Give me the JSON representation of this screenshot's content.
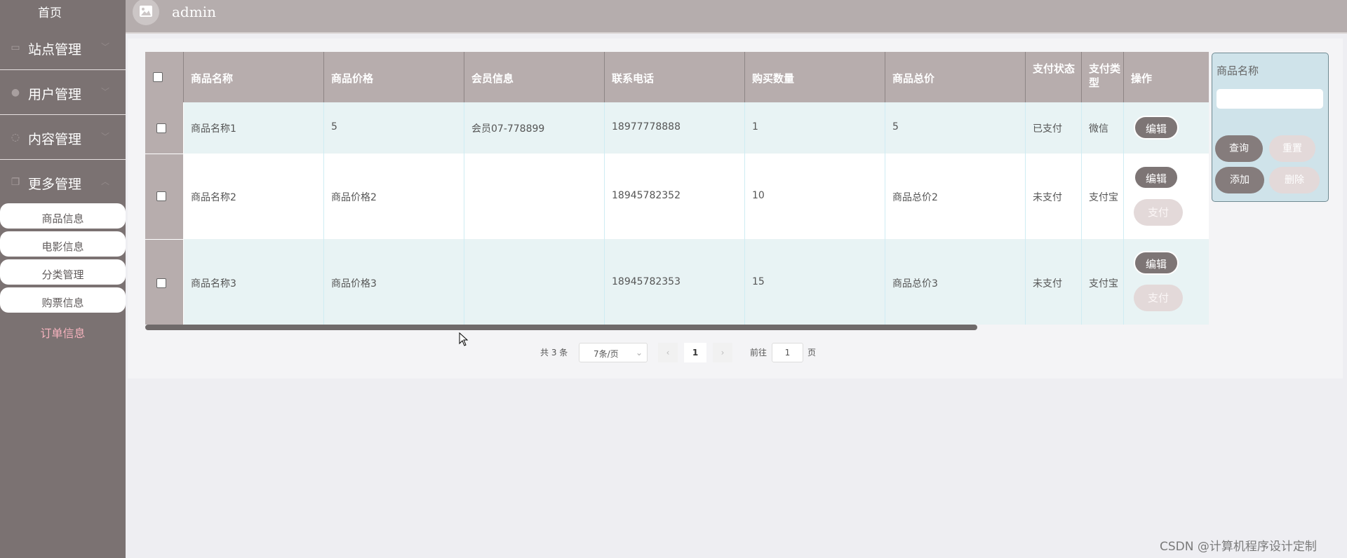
{
  "sidebar": {
    "home": "首页",
    "menus": [
      {
        "label": "站点管理",
        "icon": "monitor-icon"
      },
      {
        "label": "用户管理",
        "icon": "user-icon"
      },
      {
        "label": "内容管理",
        "icon": "chat-icon"
      },
      {
        "label": "更多管理",
        "icon": "copy-icon"
      }
    ],
    "submenu": [
      "商品信息",
      "电影信息",
      "分类管理",
      "购票信息"
    ],
    "active": "订单信息"
  },
  "header": {
    "user": "admin"
  },
  "table": {
    "columns": [
      "商品名称",
      "商品价格",
      "会员信息",
      "联系电话",
      "购买数量",
      "商品总价",
      "支付状态",
      "支付类型",
      "操作"
    ],
    "rows": [
      {
        "name": "商品名称1",
        "price": "5",
        "member": "会员07-778899",
        "phone": "18977778888",
        "qty": "1",
        "total": "5",
        "status": "已支付",
        "type": "微信",
        "actions": [
          "编辑"
        ]
      },
      {
        "name": "商品名称2",
        "price": "商品价格2",
        "member": "",
        "phone": "18945782352",
        "qty": "10",
        "total": "商品总价2",
        "status": "未支付",
        "type": "支付宝",
        "actions": [
          "编辑",
          "支付"
        ]
      },
      {
        "name": "商品名称3",
        "price": "商品价格3",
        "member": "",
        "phone": "18945782353",
        "qty": "15",
        "total": "商品总价3",
        "status": "未支付",
        "type": "支付宝",
        "actions": [
          "编辑",
          "支付"
        ]
      }
    ]
  },
  "pagination": {
    "total": "共 3 条",
    "page_size": "7条/页",
    "current": "1",
    "goto_label": "前往",
    "goto_value": "1",
    "page_unit": "页"
  },
  "search": {
    "label": "商品名称",
    "value": "",
    "query": "查询",
    "reset": "重置",
    "add": "添加",
    "delete": "删除"
  },
  "watermark": "CSDN @计算机程序设计定制",
  "colors": {
    "sidebar": "#7b7272",
    "header": "#b7adad",
    "row_alt": "#e8f3f4",
    "active_menu": "#f5b2bd",
    "search_panel": "#cfe3ea"
  }
}
